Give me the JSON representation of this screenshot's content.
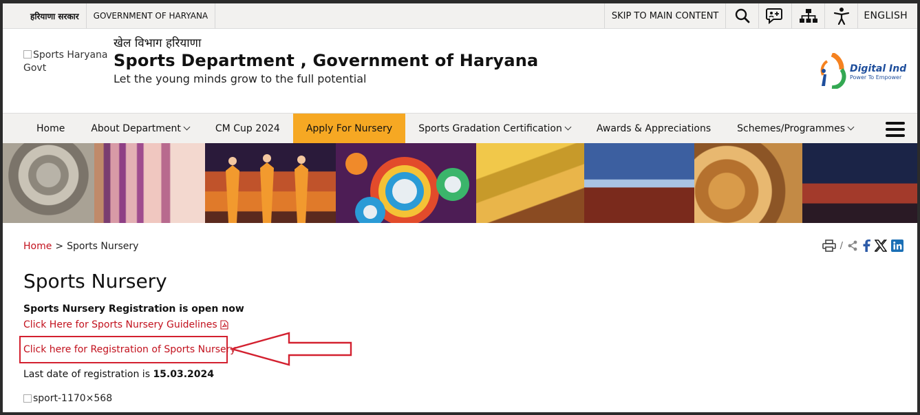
{
  "gov_bar": {
    "hindi_label": "हरियाणा सरकार",
    "english_label": "GOVERNMENT OF HARYANA",
    "skip_link": "SKIP TO MAIN CONTENT",
    "icons": [
      "search-icon",
      "feedback-chat-icon",
      "sitemap-icon",
      "accessibility-icon"
    ],
    "language": "ENGLISH"
  },
  "header": {
    "logo_alt": "Sports Haryana Govt",
    "title_hindi": "खेल विभाग हरियाणा",
    "title": "Sports Department , Government of Haryana",
    "tagline": "Let the young minds grow to the full potential",
    "digital_india": {
      "name": "Digital India",
      "tagline": "Power To Empower"
    }
  },
  "nav": {
    "items": [
      {
        "label": "Home",
        "has_dropdown": false,
        "active": false
      },
      {
        "label": "About Department",
        "has_dropdown": true,
        "active": false
      },
      {
        "label": "CM Cup 2024",
        "has_dropdown": false,
        "active": false
      },
      {
        "label": "Apply For Nursery",
        "has_dropdown": false,
        "active": true
      },
      {
        "label": "Sports Gradation Certification",
        "has_dropdown": true,
        "active": false
      },
      {
        "label": "Awards & Appreciations",
        "has_dropdown": false,
        "active": false
      },
      {
        "label": "Schemes/Programmes",
        "has_dropdown": true,
        "active": false
      }
    ],
    "active_color": "#f6a823"
  },
  "breadcrumb": {
    "home": "Home",
    "separator": ">",
    "current": "Sports Nursery"
  },
  "share": {
    "separator": "/",
    "icons": [
      "print-icon",
      "share-icon",
      "facebook-icon",
      "x-twitter-icon",
      "linkedin-icon"
    ]
  },
  "main": {
    "title": "Sports Nursery",
    "registration_status": "Sports Nursery Registration is open now",
    "guidelines_link": "Click Here for Sports Nursery Guidelines",
    "registration_link": "Click here for Registration of Sports Nursery",
    "last_date_label": "Last date of registration is ",
    "last_date_value": "15.03.2024",
    "image_alt": "sport-1170×568"
  },
  "colors": {
    "link": "#c2111d",
    "annotation": "#d3202f",
    "bar_bg": "#f2f1ef"
  }
}
